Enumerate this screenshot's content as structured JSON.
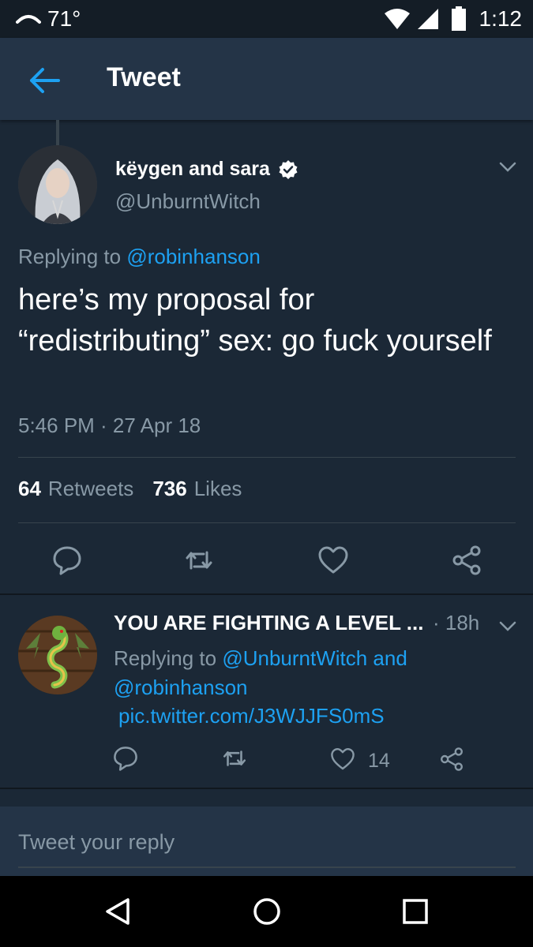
{
  "status_bar": {
    "temperature": "71°",
    "time": "1:12"
  },
  "app_bar": {
    "title": "Tweet"
  },
  "tweet": {
    "author_name": "këygen and sara",
    "author_handle": "@UnburntWitch",
    "replying_prefix": "Replying to",
    "replying_to": "@robinhanson",
    "text": "here’s my proposal for “redistributing” sex: go fuck yourself",
    "timestamp": "5:46 PM · 27 Apr 18",
    "retweets_count": "64",
    "retweets_label": "Retweets",
    "likes_count": "736",
    "likes_label": "Likes"
  },
  "reply": {
    "author_name": "YOU ARE FIGHTING A LEVEL ...",
    "time": "· 18h",
    "replying_prefix": "Replying to",
    "replying_to": "@UnburntWitch and @robinhanson",
    "link": "pic.twitter.com/J3WJJFS0mS",
    "like_count": "14"
  },
  "compose": {
    "placeholder": "Tweet your reply"
  },
  "colors": {
    "background": "#1b2836",
    "header": "#243447",
    "accent": "#1da1f2",
    "secondary_text": "#8899a6"
  },
  "icons": [
    "back-arrow-icon",
    "verified-badge-icon",
    "chevron-down-icon",
    "reply-icon",
    "retweet-icon",
    "heart-icon",
    "share-icon",
    "wifi-icon",
    "signal-icon",
    "battery-icon",
    "nav-back-icon",
    "nav-home-icon",
    "nav-recents-icon"
  ]
}
